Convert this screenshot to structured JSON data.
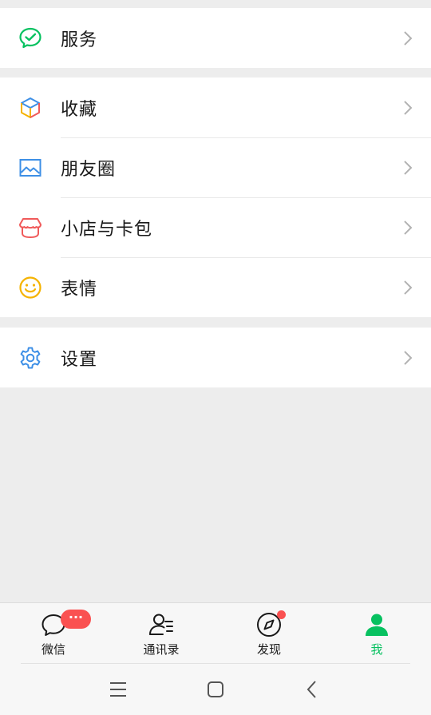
{
  "menu": {
    "services": {
      "label": "服务",
      "icon": "wechat-pay-icon"
    },
    "favorites": {
      "label": "收藏",
      "icon": "cube-icon"
    },
    "moments": {
      "label": "朋友圈",
      "icon": "image-icon"
    },
    "store_cards": {
      "label": "小店与卡包",
      "icon": "store-icon"
    },
    "stickers": {
      "label": "表情",
      "icon": "smiley-icon"
    },
    "settings": {
      "label": "设置",
      "icon": "gear-icon"
    }
  },
  "tabs": [
    {
      "label": "微信",
      "icon": "chat-icon",
      "badge": "···"
    },
    {
      "label": "通讯录",
      "icon": "contacts-icon"
    },
    {
      "label": "发现",
      "icon": "compass-icon",
      "dot": true
    },
    {
      "label": "我",
      "icon": "person-icon",
      "active": true
    }
  ],
  "colors": {
    "accent": "#07c160",
    "badge": "#fa5151",
    "background": "#ededed"
  },
  "system_nav": [
    "menu-icon",
    "home-icon",
    "back-icon"
  ]
}
